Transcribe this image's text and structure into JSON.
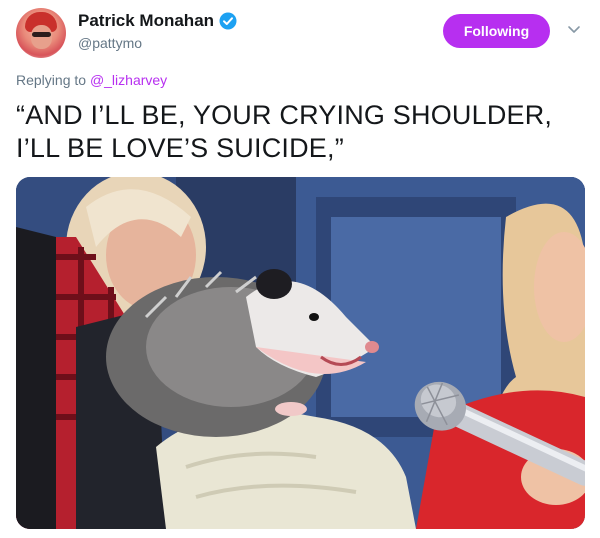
{
  "tweet": {
    "author": {
      "name": "Patrick Monahan",
      "handle": "@pattymo"
    },
    "follow_label": "Following",
    "reply": {
      "prefix": "Replying to",
      "mention": "@_lizharvey"
    },
    "text_line1": "“AND I’LL BE, YOUR CRYING SHOULDER,",
    "text_line2": "I’LL BE LOVE’S SUICIDE,”"
  },
  "colors": {
    "accent": "#b72ff0",
    "verified": "#1da1f2",
    "secondary_text": "#657786"
  },
  "icons": {
    "verified": "verified-badge-icon",
    "more": "chevron-down-icon"
  }
}
